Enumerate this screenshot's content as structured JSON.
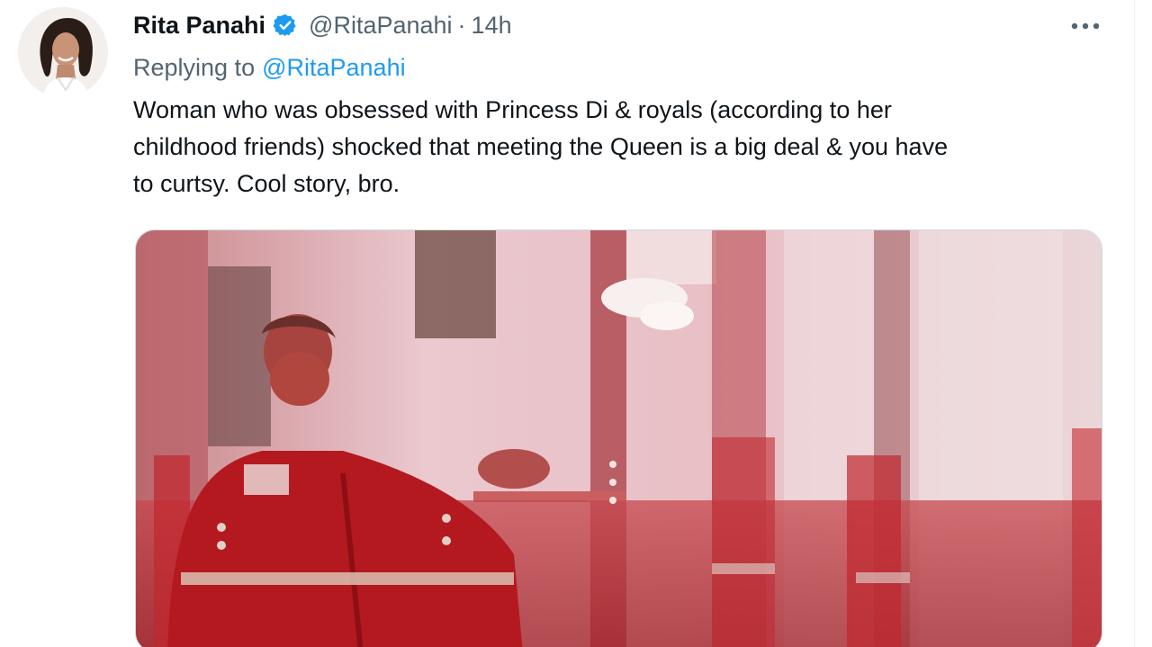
{
  "tweet": {
    "author": {
      "display_name": "Rita Panahi",
      "handle": "@RitaPanahi",
      "verified": true,
      "avatar_icon": "profile-photo"
    },
    "separator": "·",
    "timestamp": "14h",
    "more_icon": "more-horizontal-icon",
    "replying_to": {
      "label": "Replying to",
      "handle": "@RitaPanahi"
    },
    "text_lines": [
      "Woman who was obsessed with Princess Di & royals (according to her",
      "childhood friends) shocked that meeting the Queen is a big deal & you have",
      "to curtsy. Cool story, bro."
    ],
    "media": {
      "type": "image"
    }
  },
  "colors": {
    "text_primary": "#0f1419",
    "text_secondary": "#536471",
    "link": "#1d9bf0",
    "verified_badge": "#1d9bf0"
  }
}
